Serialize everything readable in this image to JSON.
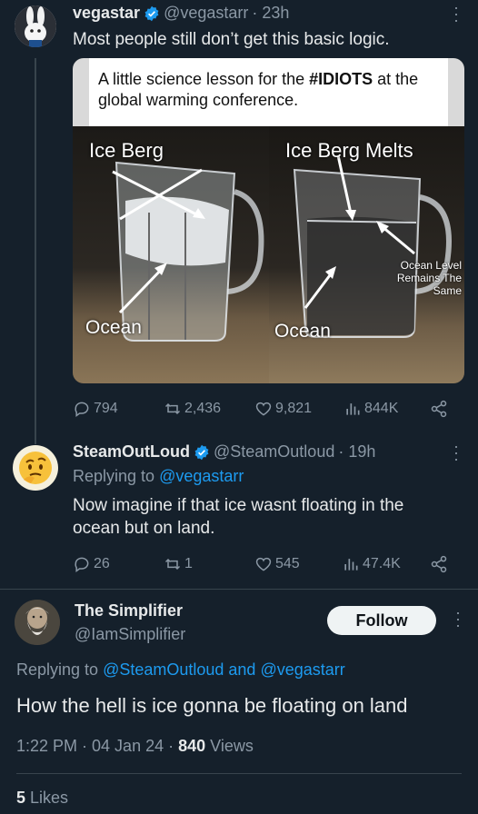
{
  "tweet1": {
    "name": "vegastar",
    "handle": "@vegastarr",
    "time": "· 23h",
    "text": "Most people still don’t get this basic logic.",
    "media": {
      "caption_pre": "A little science lesson for the ",
      "caption_bold": "#IDIOTS",
      "caption_post": " at the global warming conference.",
      "left_title": "Ice Berg",
      "right_title": "Ice Berg Melts",
      "left_ocean": "Ocean",
      "right_ocean": "Ocean",
      "annotation": "Ocean Level Remains The Same"
    },
    "stats": {
      "replies": "794",
      "retweets": "2,436",
      "likes": "9,821",
      "views": "844K"
    }
  },
  "tweet2": {
    "name": "SteamOutLoud",
    "handle": "@SteamOutloud",
    "time": "· 19h",
    "replying_label": "Replying to ",
    "replying_handle": "@vegastarr",
    "text": "Now imagine if that ice wasnt floating in the ocean but on land.",
    "stats": {
      "replies": "26",
      "retweets": "1",
      "likes": "545",
      "views": "47.4K"
    }
  },
  "tweet3": {
    "name": "The Simplifier",
    "handle": "@IamSimplifier",
    "follow_label": "Follow",
    "replying_label": "Replying to ",
    "replying_handle_1": "@SteamOutloud",
    "replying_and": " and ",
    "replying_handle_2": "@vegastarr",
    "text": "How the hell is ice gonna be floating on land",
    "timestamp": "1:22 PM · 04 Jan 24 · ",
    "views_count": "840",
    "views_label": " Views",
    "likes_count": "5",
    "likes_label": " Likes"
  },
  "colors": {
    "background": "#15202b",
    "accent": "#1d9bf0",
    "muted": "#8b98a5",
    "text": "#e7e9ea"
  }
}
